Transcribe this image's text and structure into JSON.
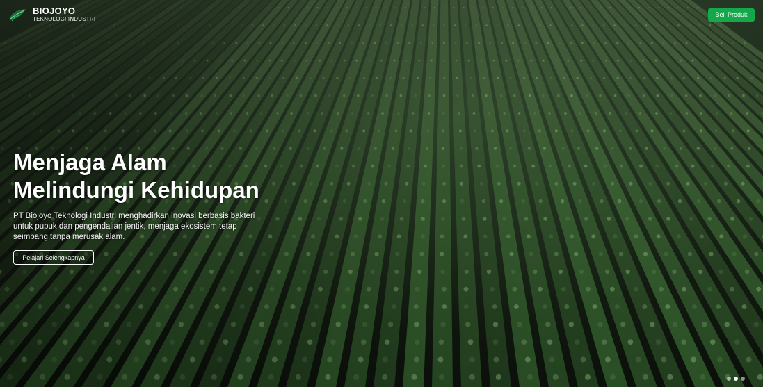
{
  "header": {
    "brand_name": "BIOJOYO",
    "brand_subtitle": "TEKNOLOGI INDUSTRI",
    "buy_button_label": "Beli Produk",
    "logo_icon": "leaf-logo-icon"
  },
  "hero": {
    "headline_line1": "Menjaga Alam",
    "headline_line2": "Melindungi Kehidupan",
    "description": "PT Biojoyo Teknologi Industri menghadirkan inovasi berbasis bakteri untuk pupuk dan pengendalian jentik, menjaga ekosistem tetap seimbang tanpa merusak alam.",
    "cta_label": "Pelajari Selengkapnya",
    "background_image": "aerial crop field rows",
    "slides_total": 3,
    "active_slide": 2
  },
  "colors": {
    "accent": "#14a84a",
    "text": "#ffffff"
  }
}
